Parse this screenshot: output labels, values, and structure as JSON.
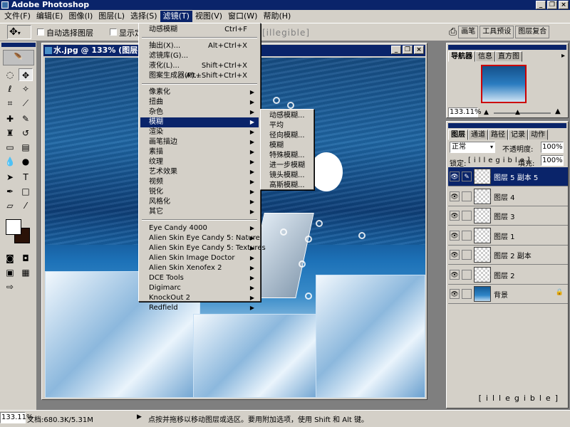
{
  "app": {
    "title": "Adobe Photoshop"
  },
  "window_buttons": {
    "minimize": "_",
    "restore": "❐",
    "close": "×"
  },
  "menubar": {
    "items": [
      {
        "label": "文件(F)"
      },
      {
        "label": "编辑(E)"
      },
      {
        "label": "图像(I)"
      },
      {
        "label": "图层(L)"
      },
      {
        "label": "选择(S)"
      },
      {
        "label": "滤镜(T)"
      },
      {
        "label": "视图(V)"
      },
      {
        "label": "窗口(W)"
      },
      {
        "label": "帮助(H)"
      }
    ],
    "active_index": 5
  },
  "options": {
    "auto_select_label": "自动选择图层",
    "show_label": "显示定",
    "aligns": "[illegible]",
    "wells": [
      "画笔",
      "工具预设",
      "图层复合"
    ]
  },
  "filter_menu": {
    "items": [
      {
        "label": "动感模糊",
        "shortcut": "Ctrl+F",
        "arrow": ""
      },
      {
        "label": "抽出(X)...",
        "shortcut": "Alt+Ctrl+X",
        "arrow": ""
      },
      {
        "label": "滤镜库(G)...",
        "shortcut": "",
        "arrow": ""
      },
      {
        "label": "液化(L)...",
        "shortcut": "Shift+Ctrl+X",
        "arrow": ""
      },
      {
        "label": "图案生成器(P)...",
        "shortcut": "Alt+Shift+Ctrl+X",
        "arrow": ""
      },
      {
        "label": "像素化",
        "shortcut": "",
        "arrow": "▶"
      },
      {
        "label": "扭曲",
        "shortcut": "",
        "arrow": "▶"
      },
      {
        "label": "杂色",
        "shortcut": "",
        "arrow": "▶"
      },
      {
        "label": "模糊",
        "shortcut": "",
        "arrow": "▶"
      },
      {
        "label": "渲染",
        "shortcut": "",
        "arrow": "▶"
      },
      {
        "label": "画笔描边",
        "shortcut": "",
        "arrow": "▶"
      },
      {
        "label": "素描",
        "shortcut": "",
        "arrow": "▶"
      },
      {
        "label": "纹理",
        "shortcut": "",
        "arrow": "▶"
      },
      {
        "label": "艺术效果",
        "shortcut": "",
        "arrow": "▶"
      },
      {
        "label": "视频",
        "shortcut": "",
        "arrow": "▶"
      },
      {
        "label": "锐化",
        "shortcut": "",
        "arrow": "▶"
      },
      {
        "label": "风格化",
        "shortcut": "",
        "arrow": "▶"
      },
      {
        "label": "其它",
        "shortcut": "",
        "arrow": "▶"
      },
      {
        "label": "Eye Candy 4000",
        "shortcut": "",
        "arrow": "▶"
      },
      {
        "label": "Alien Skin Eye Candy 5: Nature",
        "shortcut": "",
        "arrow": "▶"
      },
      {
        "label": "Alien Skin Eye Candy 5: Textures",
        "shortcut": "",
        "arrow": "▶"
      },
      {
        "label": "Alien Skin Image Doctor",
        "shortcut": "",
        "arrow": "▶"
      },
      {
        "label": "Alien Skin Xenofex 2",
        "shortcut": "",
        "arrow": "▶"
      },
      {
        "label": "DCE Tools",
        "shortcut": "",
        "arrow": "▶"
      },
      {
        "label": "Digimarc",
        "shortcut": "",
        "arrow": "▶"
      },
      {
        "label": "KnockOut 2",
        "shortcut": "",
        "arrow": "▶"
      },
      {
        "label": "Redfield",
        "shortcut": "",
        "arrow": "▶"
      }
    ],
    "highlighted_index": 8
  },
  "blur_submenu": {
    "items": [
      {
        "label": "动感模糊..."
      },
      {
        "label": "平均"
      },
      {
        "label": "径向模糊..."
      },
      {
        "label": "模糊"
      },
      {
        "label": "特殊模糊..."
      },
      {
        "label": "进一步模糊"
      },
      {
        "label": "镜头模糊..."
      },
      {
        "label": "高斯模糊..."
      }
    ]
  },
  "document": {
    "title": "水.jpg @ 133% (图层 5 副本"
  },
  "navigator": {
    "tabs": [
      "导航器",
      "信息",
      "直方图"
    ],
    "zoom": "133.11%"
  },
  "layers_panel": {
    "tabs": [
      "图层",
      "通道",
      "路径",
      "记录",
      "动作"
    ],
    "blend_mode": "正常",
    "opacity_label": "不透明度:",
    "opacity": "100%",
    "lock_label": "锁定:",
    "fill_label": "填充:",
    "fill": "100%",
    "layers": [
      {
        "name": "图层 5 副本 5",
        "selected": true
      },
      {
        "name": "图层 4",
        "selected": false
      },
      {
        "name": "图层 3",
        "selected": false
      },
      {
        "name": "图层 1",
        "selected": false
      },
      {
        "name": "图层 2 副本",
        "selected": false
      },
      {
        "name": "图层 2",
        "selected": false
      },
      {
        "name": "背景",
        "selected": false
      }
    ],
    "footer_icons": "[illegible]"
  },
  "statusbar": {
    "zoom": "133.11%",
    "doc_size": "文档:680.3K/5.31M",
    "hint": "点按并拖移以移动图层或选区。要用附加选项，使用 Shift 和 Alt 键。"
  },
  "colors": {
    "titlebar": "#0a246a",
    "chrome": "#d4d0c8",
    "highlight": "#0a246a",
    "highlight_text": "#ffffff"
  },
  "icons": {
    "app": "photoshop-icon",
    "tools": [
      "marquee-tool-icon",
      "move-tool-icon",
      "lasso-tool-icon",
      "magic-wand-icon",
      "crop-icon",
      "slice-icon",
      "healing-brush-icon",
      "brush-icon",
      "stamp-icon",
      "history-brush-icon",
      "eraser-icon",
      "gradient-icon",
      "blur-tool-icon",
      "dodge-icon",
      "path-select-icon",
      "type-icon",
      "pen-icon",
      "shape-icon",
      "notes-icon",
      "eyedropper-icon",
      "hand-icon",
      "zoom-icon"
    ]
  }
}
